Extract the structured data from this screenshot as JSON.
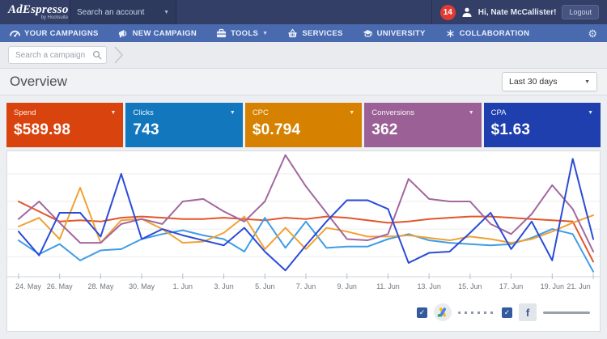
{
  "topbar": {
    "logo": {
      "brand": "AdEspresso",
      "sub": "by Hootsuite"
    },
    "account_search": {
      "label": "Search an account"
    },
    "notification_count": "14",
    "greeting": "Hi, Nate McCallister!",
    "logout_label": "Logout"
  },
  "nav": {
    "items": [
      {
        "label": "YOUR CAMPAIGNS",
        "icon": "gauge-icon"
      },
      {
        "label": "NEW CAMPAIGN",
        "icon": "megaphone-icon"
      },
      {
        "label": "TOOLS",
        "icon": "briefcase-icon",
        "has_caret": true
      },
      {
        "label": "SERVICES",
        "icon": "basket-icon"
      },
      {
        "label": "UNIVERSITY",
        "icon": "grad-cap-icon"
      },
      {
        "label": "COLLABORATION",
        "icon": "collaboration-icon"
      }
    ]
  },
  "icons": {
    "caret_down": "▼",
    "gear": "⚙",
    "check": "✓"
  },
  "campaign_search": {
    "placeholder": "Search a campaign"
  },
  "overview": {
    "title": "Overview",
    "date_range": "Last 30 days"
  },
  "metric_cards": [
    {
      "label": "Spend",
      "value": "$589.98",
      "color": "#d9430e"
    },
    {
      "label": "Clicks",
      "value": "743",
      "color": "#1277bd"
    },
    {
      "label": "CPC",
      "value": "$0.794",
      "color": "#d68200"
    },
    {
      "label": "Conversions",
      "value": "362",
      "color": "#9b6096"
    },
    {
      "label": "CPA",
      "value": "$1.63",
      "color": "#1e3fad"
    }
  ],
  "chart_data": {
    "type": "line",
    "title": "Overview metrics, last 30 days",
    "x_labels": [
      "24. May",
      "26. May",
      "28. May",
      "30. May",
      "1. Jun",
      "3. Jun",
      "5. Jun",
      "7. Jun",
      "9. Jun",
      "11. Jun",
      "13. Jun",
      "15. Jun",
      "17. Jun",
      "19. Jun",
      "21. Jun"
    ],
    "points_per_series": 29,
    "ylim": [
      0,
      105
    ],
    "grid": true,
    "gridlines": [
      16,
      38,
      60,
      82
    ],
    "legend_position": "bottom-right",
    "series": [
      {
        "name": "Spend",
        "color": "#e2562b",
        "values": [
          60,
          52,
          44,
          45,
          44,
          47,
          48,
          47,
          46,
          46,
          47,
          46,
          45,
          47,
          46,
          48,
          47,
          45,
          43,
          44,
          46,
          47,
          48,
          48,
          47,
          46,
          45,
          44,
          12
        ]
      },
      {
        "name": "Clicks",
        "color": "#3f9de6",
        "values": [
          29,
          18,
          26,
          13,
          21,
          22,
          30,
          34,
          37,
          33,
          30,
          20,
          47,
          23,
          44,
          23,
          24,
          24,
          30,
          34,
          29,
          27,
          26,
          25,
          26,
          31,
          38,
          34,
          4
        ]
      },
      {
        "name": "CPC",
        "color": "#f0a232",
        "values": [
          40,
          47,
          30,
          71,
          27,
          45,
          46,
          38,
          27,
          28,
          35,
          48,
          22,
          39,
          22,
          39,
          36,
          32,
          32,
          33,
          31,
          29,
          32,
          30,
          27,
          30,
          36,
          43,
          49
        ]
      },
      {
        "name": "Conversions",
        "color": "#a2679e",
        "values": [
          46,
          60,
          43,
          27,
          27,
          42,
          46,
          42,
          60,
          62,
          52,
          44,
          60,
          97,
          72,
          51,
          30,
          29,
          34,
          78,
          62,
          60,
          60,
          42,
          34,
          50,
          73,
          54,
          20
        ]
      },
      {
        "name": "CPA",
        "color": "#2b4bd7",
        "values": [
          36,
          17,
          51,
          51,
          32,
          82,
          30,
          38,
          33,
          29,
          25,
          39,
          20,
          5,
          25,
          44,
          61,
          61,
          54,
          11,
          19,
          20,
          35,
          51,
          22,
          44,
          13,
          94,
          30
        ]
      }
    ]
  },
  "chart_legend": {
    "facebook_letter": "f",
    "items": [
      {
        "name": "google-ads",
        "checkbox_checked": true,
        "icon": "google-ads-icon",
        "line_style": "dotted"
      },
      {
        "name": "facebook",
        "checkbox_checked": true,
        "icon": "facebook-icon",
        "line_style": "solid"
      }
    ]
  }
}
